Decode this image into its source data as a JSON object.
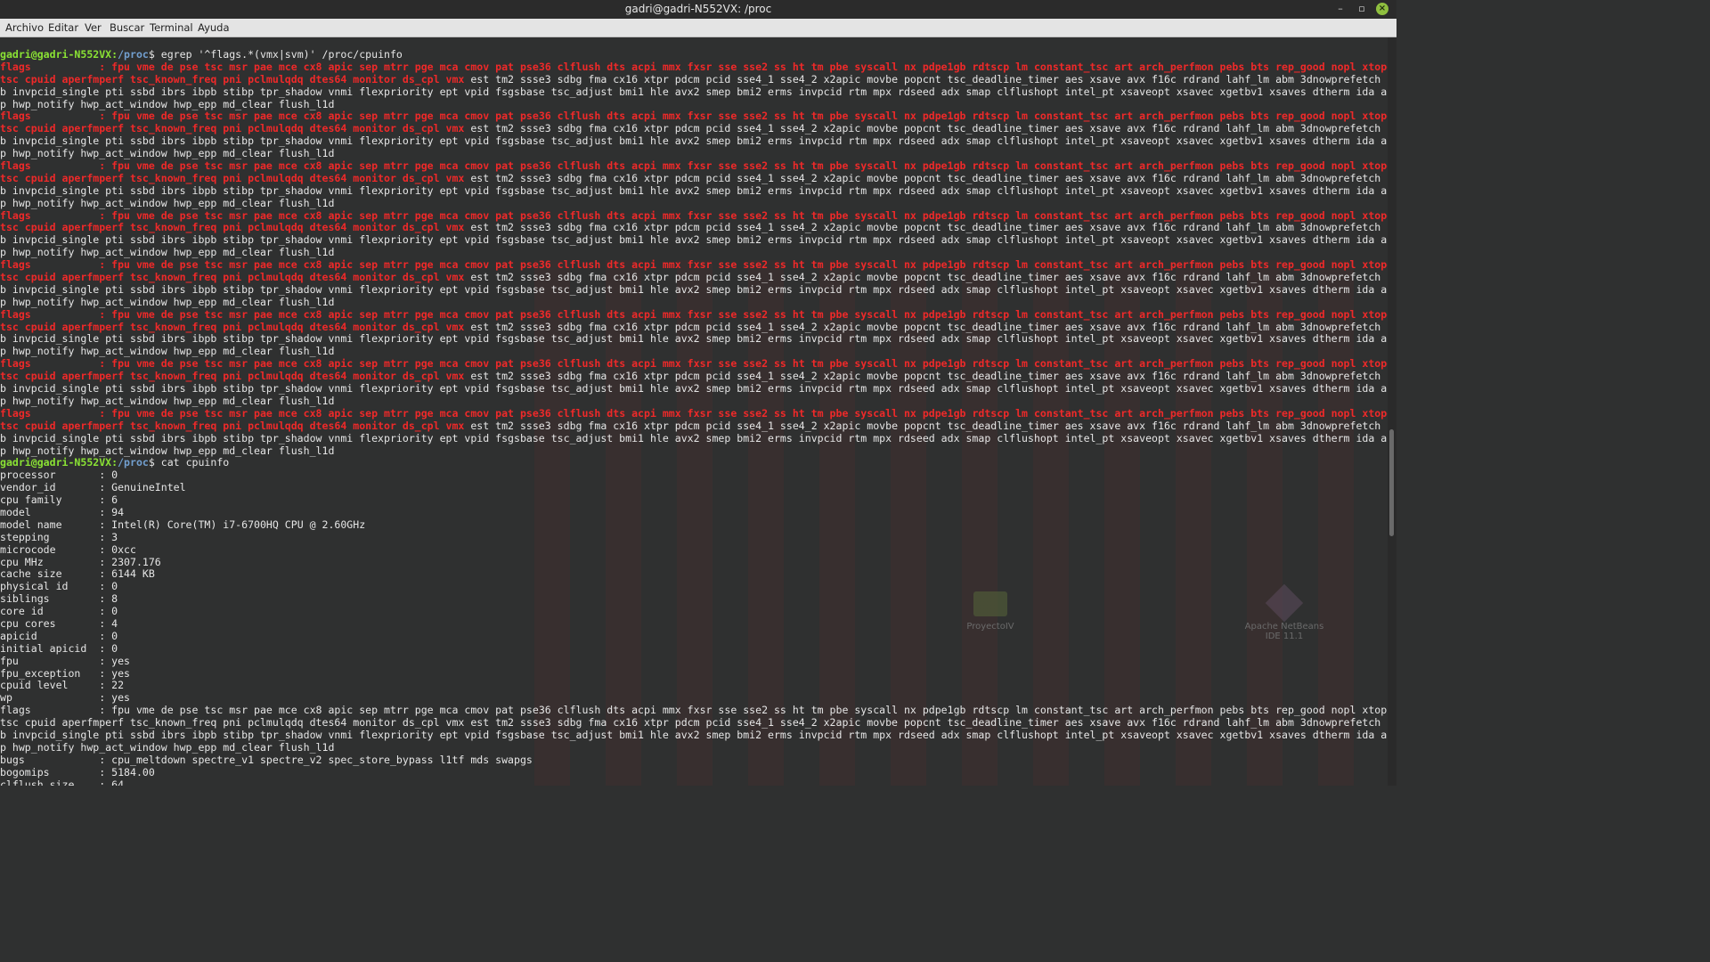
{
  "window": {
    "title": "gadri@gadri-N552VX: /proc",
    "minimize_glyph": "–",
    "maximize_glyph": "▫",
    "close_glyph": "×"
  },
  "menu": [
    "Archivo",
    "Editar",
    "Ver",
    "Buscar",
    "Terminal",
    "Ayuda"
  ],
  "prompt": {
    "user": "gadri@gadri-N552VX:",
    "path": "/proc",
    "sign": "$"
  },
  "commands": {
    "egrep": " egrep '^flags.*(vmx|svm)' /proc/cpuinfo",
    "cat": " cat cpuinfo"
  },
  "flag_block": {
    "head_label": "flags\t\t: ",
    "head_text": "fpu vme de pse tsc msr pae mce cx8 apic sep mtrr pge mca cmov pat pse36 clflush dts acpi mmx fxsr sse sse2 ss ht tm pbe syscall nx pdpe1gb rdtscp lm constant_tsc art arch_perfmon pebs bts rep_good nopl xtopology nonstop_",
    "line2_hl": "tsc cpuid aperfmperf tsc_known_freq pni pclmulqdq dtes64 monitor ds_cpl vmx",
    "line2_rest": " est tm2 ssse3 sdbg fma cx16 xtpr pdcm pcid sse4_1 sse4_2 x2apic movbe popcnt tsc_deadline_timer aes xsave avx f16c rdrand lahf_lm abm 3dnowprefetch cpuid_fault ep",
    "line3": "b invpcid_single pti ssbd ibrs ibpb stibp tpr_shadow vnmi flexpriority ept vpid fsgsbase tsc_adjust bmi1 hle avx2 smep bmi2 erms invpcid rtm mpx rdseed adx smap clflushopt intel_pt xsaveopt xsavec xgetbv1 xsaves dtherm ida arat pln pts hw",
    "line4": "p hwp_notify hwp_act_window hwp_epp md_clear flush_l1d",
    "count": 8
  },
  "cpuinfo": [
    {
      "key": "processor",
      "value": "0"
    },
    {
      "key": "vendor_id",
      "value": "GenuineIntel"
    },
    {
      "key": "cpu family",
      "value": "6"
    },
    {
      "key": "model",
      "value": "94"
    },
    {
      "key": "model name",
      "value": "Intel(R) Core(TM) i7-6700HQ CPU @ 2.60GHz"
    },
    {
      "key": "stepping",
      "value": "3"
    },
    {
      "key": "microcode",
      "value": "0xcc"
    },
    {
      "key": "cpu MHz",
      "value": "2307.176"
    },
    {
      "key": "cache size",
      "value": "6144 KB"
    },
    {
      "key": "physical id",
      "value": "0"
    },
    {
      "key": "siblings",
      "value": "8"
    },
    {
      "key": "core id",
      "value": "0"
    },
    {
      "key": "cpu cores",
      "value": "4"
    },
    {
      "key": "apicid",
      "value": "0"
    },
    {
      "key": "initial apicid",
      "value": "0"
    },
    {
      "key": "fpu",
      "value": "yes"
    },
    {
      "key": "fpu_exception",
      "value": "yes"
    },
    {
      "key": "cpuid level",
      "value": "22"
    },
    {
      "key": "wp",
      "value": "yes"
    }
  ],
  "cpuinfo_flags": {
    "key": "flags",
    "line1": "fpu vme de pse tsc msr pae mce cx8 apic sep mtrr pge mca cmov pat pse36 clflush dts acpi mmx fxsr sse sse2 ss ht tm pbe syscall nx pdpe1gb rdtscp lm constant_tsc art arch_perfmon pebs bts rep_good nopl xtopology nonstop_",
    "line2": "tsc cpuid aperfmperf tsc_known_freq pni pclmulqdq dtes64 monitor ds_cpl vmx est tm2 ssse3 sdbg fma cx16 xtpr pdcm pcid sse4_1 sse4_2 x2apic movbe popcnt tsc_deadline_timer aes xsave avx f16c rdrand lahf_lm abm 3dnowprefetch cpuid_fault ep",
    "line3": "b invpcid_single pti ssbd ibrs ibpb stibp tpr_shadow vnmi flexpriority ept vpid fsgsbase tsc_adjust bmi1 hle avx2 smep bmi2 erms invpcid rtm mpx rdseed adx smap clflushopt intel_pt xsaveopt xsavec xgetbv1 xsaves dtherm ida arat pln pts hw",
    "line4": "p hwp_notify hwp_act_window hwp_epp md_clear flush_l1d"
  },
  "cpuinfo_tail": [
    {
      "key": "bugs",
      "value": "cpu_meltdown spectre_v1 spectre_v2 spec_store_bypass l1tf mds swapgs"
    },
    {
      "key": "bogomips",
      "value": "5184.00"
    },
    {
      "key": "clflush size",
      "value": "64"
    }
  ],
  "desktop": {
    "icons": [
      {
        "label": "ProyectoIV",
        "kind": "folder"
      },
      {
        "label": "Apache NetBeans IDE 11.1",
        "kind": "app"
      }
    ]
  },
  "colors": {
    "prompt_user": "#8ae234",
    "prompt_path": "#729fcf",
    "grep_match": "#ef2929",
    "text": "#e6e6e6",
    "background": "#2f3030"
  }
}
